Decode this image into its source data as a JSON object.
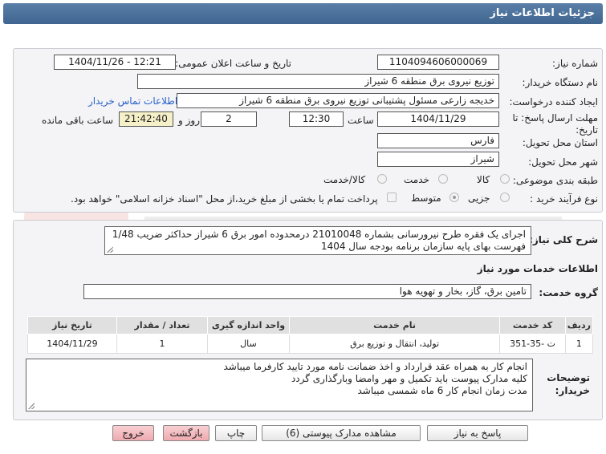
{
  "header": {
    "title": "جزئیات اطلاعات نیاز"
  },
  "fields": {
    "need_number_label": "شماره نیاز:",
    "need_number": "1104094606000069",
    "announce_label": "تاریخ و ساعت اعلان عمومی:",
    "announce_value": "1404/11/26 - 12:21",
    "buyer_org_label": "نام دستگاه خریدار:",
    "buyer_org": "توزیع نیروی برق منطقه 6 شیراز",
    "requester_label": "ایجاد کننده درخواست:",
    "requester": "خدیجه زارعی مسئول پشتیبانی توزیع نیروی برق منطقه 6 شیراز",
    "contact_link": "اطلاعات تماس خریدار",
    "deadline_label_1": "مهلت ارسال پاسخ: تا",
    "deadline_label_2": "تاریخ:",
    "deadline_date": "1404/11/29",
    "time_label": "ساعت",
    "deadline_time": "12:30",
    "days_value": "2",
    "days_label": "روز و",
    "remaining_time": "21:42:40",
    "remaining_label": "ساعت باقی مانده",
    "province_label": "استان محل تحویل:",
    "province": "فارس",
    "city_label": "شهر محل تحویل:",
    "city": "شیراز",
    "category_label": "طبقه بندی موضوعی:",
    "category_options": [
      "کالا",
      "خدمت",
      "کالا/خدمت"
    ],
    "process_label": "نوع فرآیند خرید :",
    "process_options": [
      "جزیی",
      "متوسط"
    ],
    "payment_note": "پرداخت تمام یا بخشی از مبلغ خرید،از محل \"اسناد خزانه اسلامی\" خواهد بود."
  },
  "summary": {
    "label": "شرح کلی نیاز:",
    "text": "اجرای یک فقره طرح نیرورسانی بشماره 21010048 درمحدوده امور برق 6 شیراز حداکثر ضریب 1/48 فهرست بهای پایه سازمان برنامه بودجه سال 1404"
  },
  "services": {
    "section_title": "اطلاعات خدمات مورد نیاز",
    "group_label": "گروه خدمت:",
    "group_value": "تامین برق، گاز، بخار و تهویه هوا",
    "columns": [
      "ردیف",
      "کد خدمت",
      "نام خدمت",
      "واحد اندازه گیری",
      "تعداد / مقدار",
      "تاریخ نیاز"
    ],
    "rows": [
      [
        "1",
        "ت -35-351",
        "تولید، انتقال و توزیع برق",
        "سال",
        "1",
        "1404/11/29"
      ]
    ]
  },
  "notes": {
    "label_1": "توضیحات",
    "label_2": "خریدار:",
    "lines": [
      "انجام کار به همراه عقد قرارداد و اخذ ضمانت نامه مورد تایید کارفرما میباشد",
      "کلیه مدارک پیوست باید تکمیل و مهر وامضا وبارگذاری گردد",
      "مدت زمان انجام کار 6 ماه شمسی میباشد"
    ]
  },
  "buttons": {
    "reply": "پاسخ به نیاز",
    "attachments": "مشاهده مدارک پیوستی (6)",
    "print": "چاپ",
    "back": "بازگشت",
    "exit": "خروج"
  },
  "colors": {
    "header": "#4a6f98",
    "pink_button": "#f2b8bd",
    "link": "#2a62c9",
    "remaining_bg": "#f5f0c8"
  }
}
